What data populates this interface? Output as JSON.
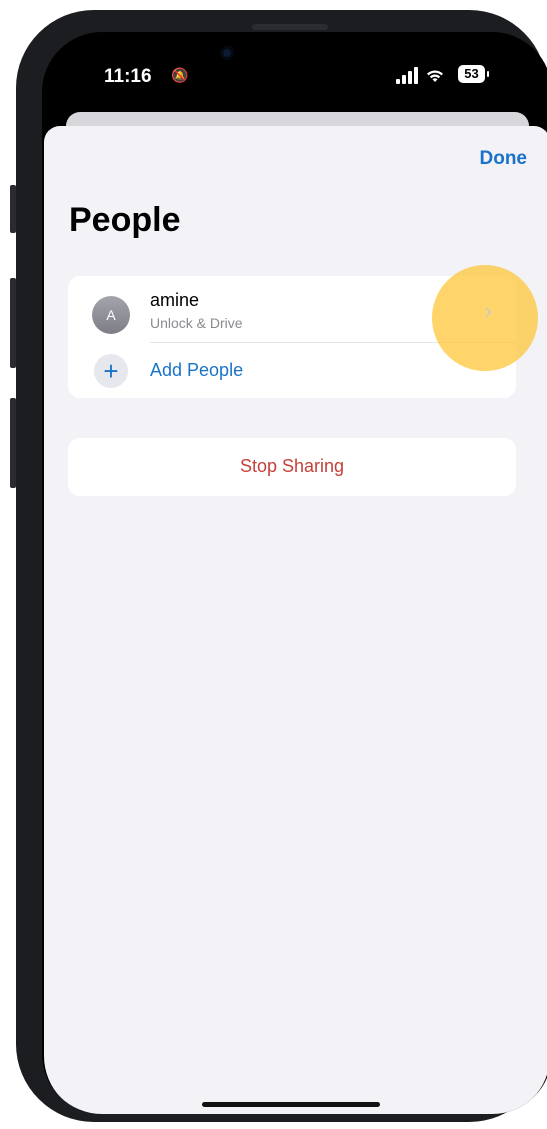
{
  "status_bar": {
    "time": "11:16",
    "silent_icon": "bell-slash-icon",
    "signal_icon": "cellular-signal-icon",
    "wifi_icon": "wifi-icon",
    "battery": "53"
  },
  "header": {
    "done_label": "Done",
    "title": "People"
  },
  "people": [
    {
      "avatar_initial": "A",
      "name": "amine",
      "permission": "Unlock & Drive",
      "chevron": "›"
    }
  ],
  "add_people": {
    "icon": "+",
    "label": "Add People"
  },
  "stop_sharing_label": "Stop Sharing",
  "colors": {
    "accent": "#1a73c8",
    "destructive": "#c6403a",
    "highlight": "#ffc32c",
    "background": "#f2f2f7"
  }
}
